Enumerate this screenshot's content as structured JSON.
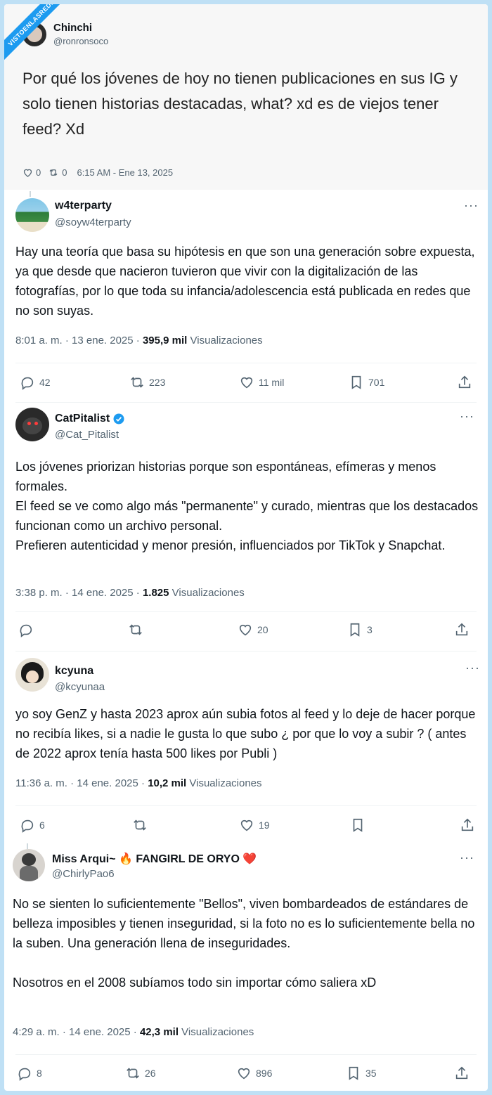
{
  "watermark": "VISTOENLASREDES",
  "first_post": {
    "name": "Chinchi",
    "handle": "@ronronsoco",
    "text": "Por qué los jóvenes de hoy no tienen publicaciones en sus IG y solo tienen historias destacadas, what? xd es de viejos tener feed? Xd",
    "likes": "0",
    "retweets": "0",
    "timestamp": "6:15 AM - Ene 13, 2025"
  },
  "replies": [
    {
      "name": "w4terparty",
      "handle": "@soyw4terparty",
      "text": "Hay una teoría que basa su hipótesis en que son una generación sobre expuesta, ya que desde que nacieron tuvieron que vivir con la digitalización de las fotografías, por lo que toda su infancia/adolescencia está publicada en redes que no son suyas.",
      "time": "8:01 a. m. · 13 ene. 2025 · ",
      "views": "395,9 mil",
      "views_label": " Visualizaciones",
      "replies": "42",
      "reposts": "223",
      "likes": "11 mil",
      "bookmarks": "701"
    },
    {
      "name": "CatPitalist",
      "handle": "@Cat_Pitalist",
      "text": "Los jóvenes priorizan historias porque son espontáneas, efímeras y menos formales.\nEl feed se ve como algo más \"permanente\" y curado, mientras que los destacados funcionan como un archivo personal.\nPrefieren autenticidad y menor presión, influenciados por TikTok y Snapchat.",
      "time": "3:38 p. m. · 14 ene. 2025 · ",
      "views": "1.825",
      "views_label": " Visualizaciones",
      "replies": "",
      "reposts": "",
      "likes": "20",
      "bookmarks": "3"
    },
    {
      "name": "kcyuna",
      "handle": "@kcyunaa",
      "text": "yo soy GenZ y hasta 2023 aprox aún subia fotos al feed y lo deje de hacer porque no recibía likes, si a nadie le gusta lo que subo ¿ por que lo voy a subir ? ( antes de 2022 aprox tenía hasta 500 likes por Publi )",
      "time": "11:36 a. m. · 14 ene. 2025 · ",
      "views": "10,2 mil",
      "views_label": " Visualizaciones",
      "replies": "6",
      "reposts": "",
      "likes": "19",
      "bookmarks": ""
    },
    {
      "name": "Miss Arqui~ 🔥 FANGIRL DE ORYO ❤️",
      "handle": "@ChirlyPao6",
      "text": "No se sienten lo suficientemente \"Bellos\", viven bombardeados de estándares de belleza imposibles y tienen inseguridad, si la foto no es lo suficientemente bella no la suben. Una generación llena de inseguridades.\n\nNosotros en el 2008 subíamos todo sin importar cómo saliera xD",
      "time": "4:29 a. m. · 14 ene. 2025 · ",
      "views": "42,3 mil",
      "views_label": " Visualizaciones",
      "replies": "8",
      "reposts": "26",
      "likes": "896",
      "bookmarks": "35"
    }
  ],
  "colors": {
    "verified": "#1d9bf0",
    "muted": "#536471",
    "text": "#0f1419"
  }
}
